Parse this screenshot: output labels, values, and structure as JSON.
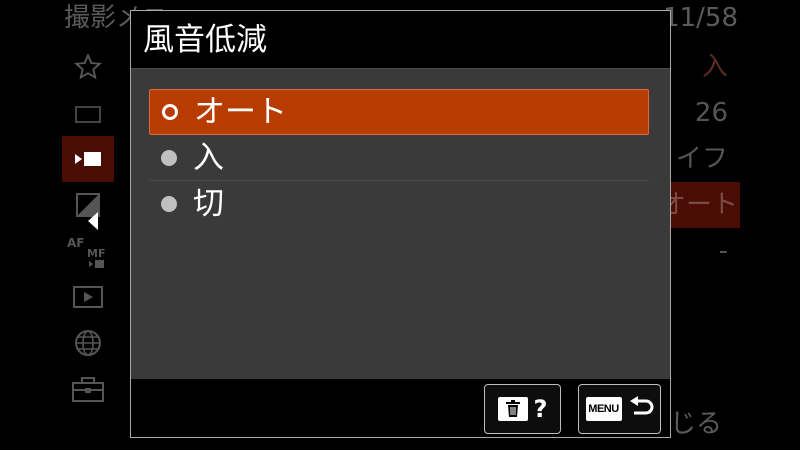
{
  "background": {
    "header_text": "撮影メニュー",
    "page_indicator": "11/58",
    "sidebar_icons": [
      {
        "icon": "star-icon",
        "active": false
      },
      {
        "icon": "still-camera-icon",
        "active": false
      },
      {
        "icon": "movie-icon",
        "active": true
      },
      {
        "icon": "exposure-icon",
        "active": false
      },
      {
        "icon": "af-mf-icon",
        "active": false
      },
      {
        "icon": "playback-icon",
        "active": false
      },
      {
        "icon": "globe-icon",
        "active": false
      },
      {
        "icon": "toolbox-icon",
        "active": false
      }
    ],
    "values": [
      "入",
      "26",
      "イフ",
      "オート",
      "-"
    ],
    "close_label": "閉じる"
  },
  "dialog": {
    "title": "風音低減",
    "options": [
      {
        "label": "オート",
        "selected": true
      },
      {
        "label": "入",
        "selected": false
      },
      {
        "label": "切",
        "selected": false
      }
    ],
    "help_button": {
      "icon": "trash-icon",
      "label": "?"
    },
    "back_button": {
      "icon_text": "MENU",
      "icon": "return-arrow-icon"
    }
  },
  "colors": {
    "selected_option": "#b83c00",
    "dialog_body": "#3a3a3a",
    "dialog_border": "#a8a8a8"
  }
}
